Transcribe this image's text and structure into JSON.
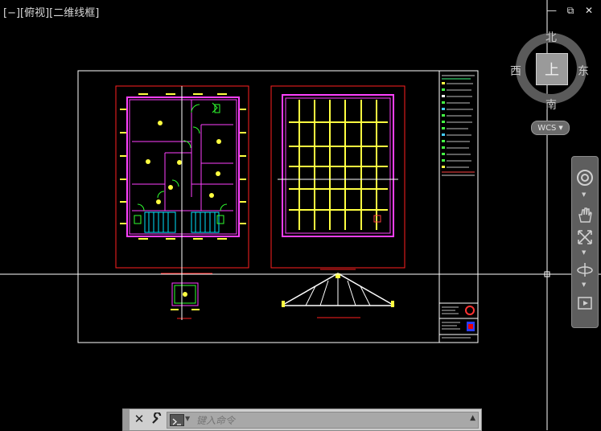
{
  "viewport": {
    "label": "[−][俯视][二维线框]"
  },
  "window_controls": {
    "minimize": "—",
    "restore": "⧉",
    "close": "✕"
  },
  "viewcube": {
    "north": "北",
    "south": "南",
    "east": "东",
    "west": "西",
    "top": "上",
    "wcs": "WCS"
  },
  "nav_bar": {
    "tools": [
      "steering-wheel",
      "pan",
      "zoom-extents",
      "orbit",
      "showmotion"
    ]
  },
  "command_line": {
    "placeholder": "键入命令",
    "close": "✕"
  },
  "colors": {
    "background": "#000000",
    "crosshair": "#ffffff",
    "border_red": "#ff2020",
    "wall_pink": "#ff40ff",
    "grid_yellow": "#ffff40",
    "ui_gray": "#5e5e5e"
  }
}
